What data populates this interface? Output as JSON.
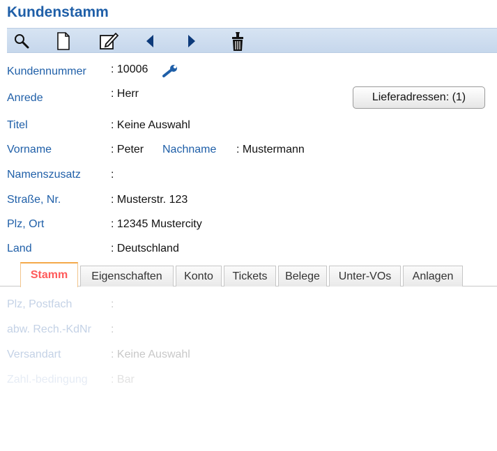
{
  "window": {
    "title": "Kundenstamm"
  },
  "toolbar": {
    "icons": [
      "search-icon",
      "new-document-icon",
      "edit-icon",
      "previous-icon",
      "next-icon",
      "delete-icon"
    ]
  },
  "fields": {
    "kundennummer": {
      "label": "Kundennummer",
      "value": ": 10006"
    },
    "anrede": {
      "label": "Anrede",
      "value": ": Herr"
    },
    "titel": {
      "label": "Titel",
      "value": ": Keine Auswahl"
    },
    "vorname": {
      "label": "Vorname",
      "value": ": Peter"
    },
    "nachname": {
      "label": "Nachname",
      "value": ": Mustermann"
    },
    "namenszusatz": {
      "label": "Namenszusatz",
      "value": ":"
    },
    "strasse": {
      "label": "Straße, Nr.",
      "value": ": Musterstr. 123"
    },
    "plz_ort": {
      "label": "Plz, Ort",
      "value": ": 12345 Mustercity"
    },
    "land": {
      "label": "Land",
      "value": ": Deutschland"
    }
  },
  "lieferadressen_button": "Lieferadressen: (1)",
  "tabs": [
    "Stamm",
    "Eigenschaften",
    "Konto",
    "Tickets",
    "Belege",
    "Unter-VOs",
    "Anlagen"
  ],
  "active_tab": "Stamm",
  "tab_fields": {
    "plz_postfach": {
      "label": "Plz, Postfach",
      "value": ":"
    },
    "abw_rech": {
      "label": "abw. Rech.-KdNr",
      "value": ":"
    },
    "versandart": {
      "label": "Versandart",
      "value": ": Keine Auswahl"
    },
    "zahlbedingung": {
      "label": "Zahl.-bedingung",
      "value": ": Bar"
    }
  },
  "colors": {
    "label": "#1f5fa8",
    "toolbar": "#c6d7ec",
    "active_tab_text": "#ff5a5a",
    "active_tab_border": "#f4a94a"
  }
}
